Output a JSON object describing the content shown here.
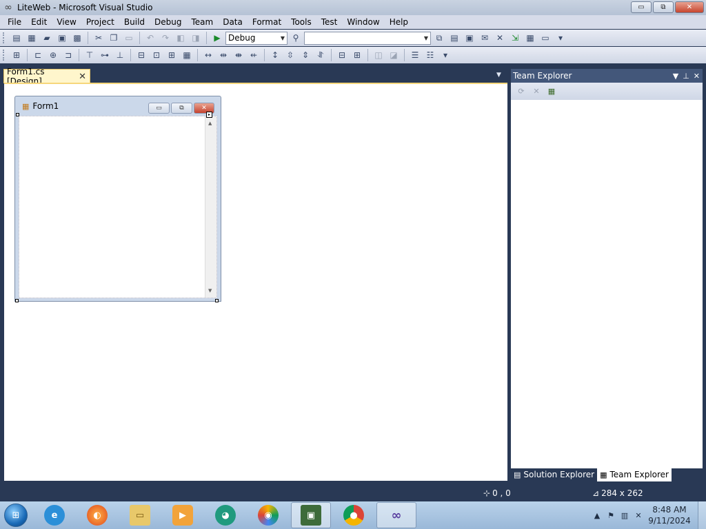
{
  "window": {
    "title": "LiteWeb - Microsoft Visual Studio",
    "controls": {
      "minimize": "▭",
      "restore": "⧉",
      "close": "✕"
    }
  },
  "menu": [
    "File",
    "Edit",
    "View",
    "Project",
    "Build",
    "Debug",
    "Team",
    "Data",
    "Format",
    "Tools",
    "Test",
    "Window",
    "Help"
  ],
  "toolbar": {
    "configuration": "Debug",
    "platform": ""
  },
  "document_tab": {
    "label": "Form1.cs [Design]",
    "close": "✕"
  },
  "form": {
    "title": "Form1"
  },
  "team_explorer": {
    "title": "Team Explorer"
  },
  "bottom_tabs": {
    "solution_explorer": "Solution Explorer",
    "team_explorer": "Team Explorer"
  },
  "status": {
    "position": "0 , 0",
    "size": "284 x 262"
  },
  "taskbar": {
    "clock_time": "8:48 AM",
    "clock_date": "9/11/2024"
  },
  "colors": {
    "vs_background": "#293955",
    "tab_active": "#fff6cc",
    "tab_border": "#e5c365",
    "team_header": "#43577a"
  }
}
